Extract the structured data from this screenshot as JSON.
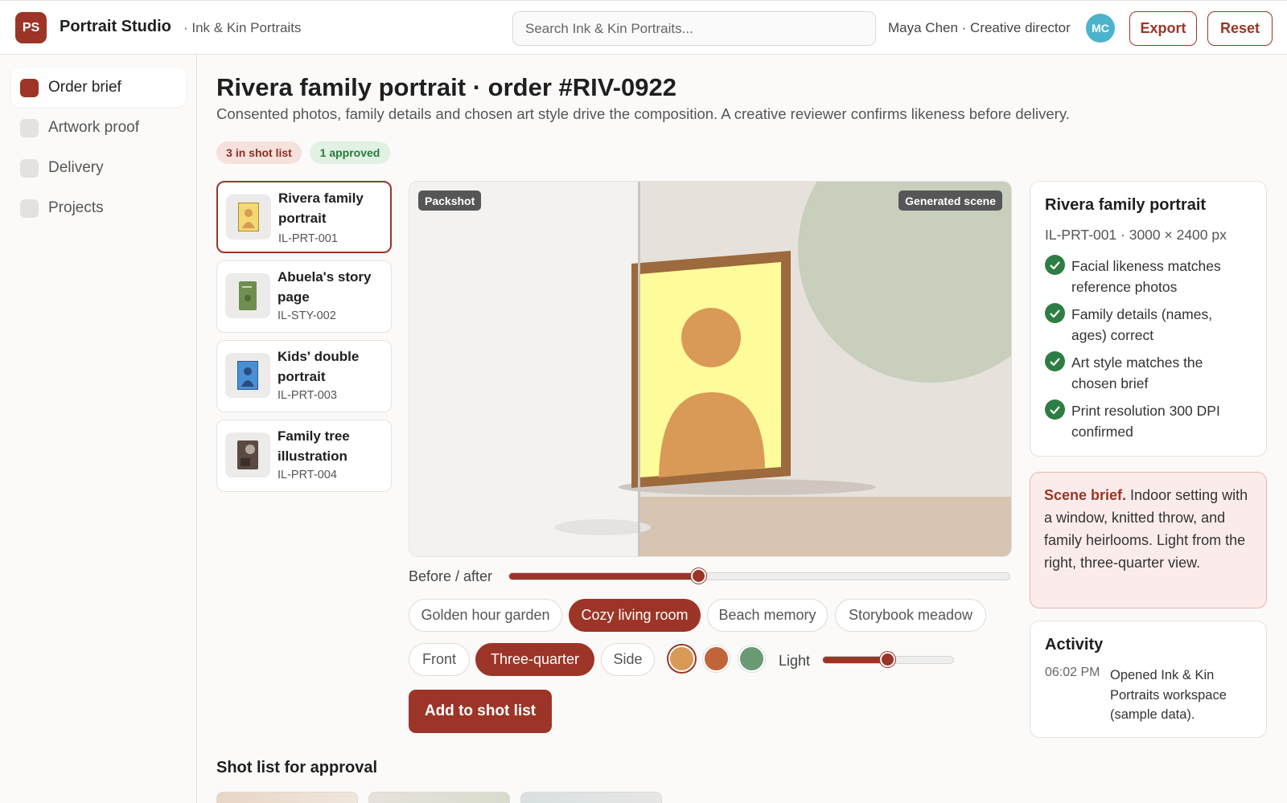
{
  "header": {
    "logo_initials": "PS",
    "app_name": "Portrait Studio",
    "workspace": "· Ink & Kin Portraits",
    "search_placeholder": "Search Ink & Kin Portraits...",
    "user": "Maya Chen · Creative director",
    "avatar_initials": "MC",
    "export_label": "Export",
    "reset_label": "Reset"
  },
  "sidebar": {
    "items": [
      {
        "label": "Order brief",
        "active": true
      },
      {
        "label": "Artwork proof",
        "active": false
      },
      {
        "label": "Delivery",
        "active": false
      },
      {
        "label": "Projects",
        "active": false
      }
    ]
  },
  "main": {
    "title": "Rivera family portrait · order #RIV-0922",
    "subtitle": "Consented photos, family details and chosen art style drive the composition. A creative reviewer confirms likeness before delivery.",
    "pill_shotlist": "3 in shot list",
    "pill_approved": "1 approved"
  },
  "products": [
    {
      "name": "Rivera family portrait",
      "sku": "IL-PRT-001",
      "selected": true,
      "icon_color": "#f2d970"
    },
    {
      "name": "Abuela's story page",
      "sku": "IL-STY-002",
      "selected": false,
      "icon_color": "#6e8f4e"
    },
    {
      "name": "Kids' double portrait",
      "sku": "IL-PRT-003",
      "selected": false,
      "icon_color": "#4a8fd4"
    },
    {
      "name": "Family tree illustration",
      "sku": "IL-PRT-004",
      "selected": false,
      "icon_color": "#5a4a42"
    }
  ],
  "stage": {
    "packshot_tag": "Packshot",
    "generated_tag": "Generated scene"
  },
  "controls": {
    "before_after_label": "Before / after",
    "before_after_value": 0.38,
    "scenes": [
      {
        "label": "Golden hour garden",
        "selected": false
      },
      {
        "label": "Cozy living room",
        "selected": true
      },
      {
        "label": "Beach memory",
        "selected": false
      },
      {
        "label": "Storybook meadow",
        "selected": false
      }
    ],
    "angles": [
      {
        "label": "Front",
        "selected": false
      },
      {
        "label": "Three-quarter",
        "selected": true
      },
      {
        "label": "Side",
        "selected": false
      }
    ],
    "swatches": [
      {
        "color": "#d99a58",
        "selected": true
      },
      {
        "color": "#c0653a",
        "selected": false
      },
      {
        "color": "#6a9a73",
        "selected": false
      }
    ],
    "light_label": "Light",
    "light_value": 0.5,
    "add_button": "Add to shot list"
  },
  "shotlist": {
    "title": "Shot list for approval"
  },
  "details": {
    "title": "Rivera family portrait",
    "meta": "IL-PRT-001 · 3000 × 2400 px",
    "checks": [
      "Facial likeness matches reference photos",
      "Family details (names, ages) correct",
      "Art style matches the chosen brief",
      "Print resolution 300 DPI confirmed"
    ]
  },
  "brief": {
    "heading": "Scene brief.",
    "text": " Indoor setting with a window, knitted throw, and family heirlooms. Light from the right, three-quarter view."
  },
  "activity": {
    "title": "Activity",
    "entries": [
      {
        "time": "06:02 PM",
        "text": "Opened Ink & Kin Portraits workspace (sample data)."
      }
    ]
  },
  "colors": {
    "accent": "#9c3527",
    "success": "#2e7d44"
  }
}
